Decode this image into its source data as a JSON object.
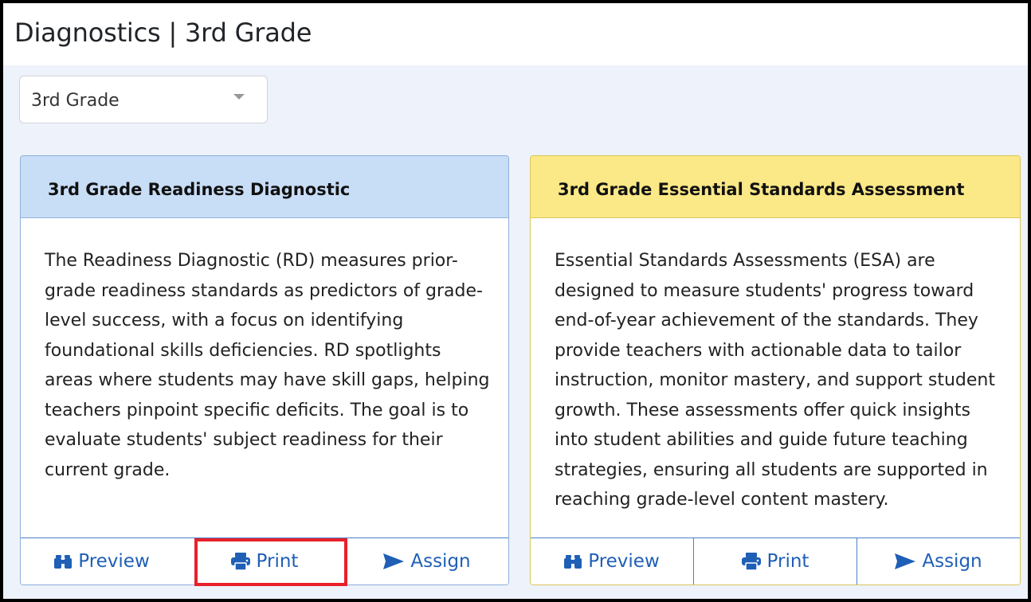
{
  "page": {
    "title": "Diagnostics | 3rd Grade"
  },
  "grade_select": {
    "value": "3rd Grade"
  },
  "cards": [
    {
      "title": "3rd Grade Readiness Diagnostic",
      "description": "The Readiness Diagnostic (RD) measures prior-grade readiness standards as predictors of grade-level success, with a focus on identifying foundational skills deficiencies. RD spotlights areas where students may have skill gaps, helping teachers pinpoint specific deficits. The goal is to evaluate students' subject readiness for their current grade.",
      "header_color": "#c8ddf6",
      "actions": {
        "preview": "Preview",
        "print": "Print",
        "assign": "Assign"
      }
    },
    {
      "title": "3rd Grade Essential Standards Assessment",
      "description": "Essential Standards Assessments (ESA) are designed to measure students' progress toward end-of-year achievement of the standards. They provide teachers with actionable data to tailor instruction, monitor mastery, and support student growth. These assessments offer quick insights into student abilities and guide future teaching strategies, ensuring all students are supported in reaching grade-level content mastery.",
      "header_color": "#fbe886",
      "actions": {
        "preview": "Preview",
        "print": "Print",
        "assign": "Assign"
      }
    }
  ],
  "colors": {
    "link": "#1f5fb6",
    "highlight": "#e8202a",
    "background": "#eef2fa"
  },
  "icons": {
    "preview": "binoculars-icon",
    "print": "printer-icon",
    "assign": "paper-plane-icon",
    "dropdown": "caret-down-icon"
  }
}
